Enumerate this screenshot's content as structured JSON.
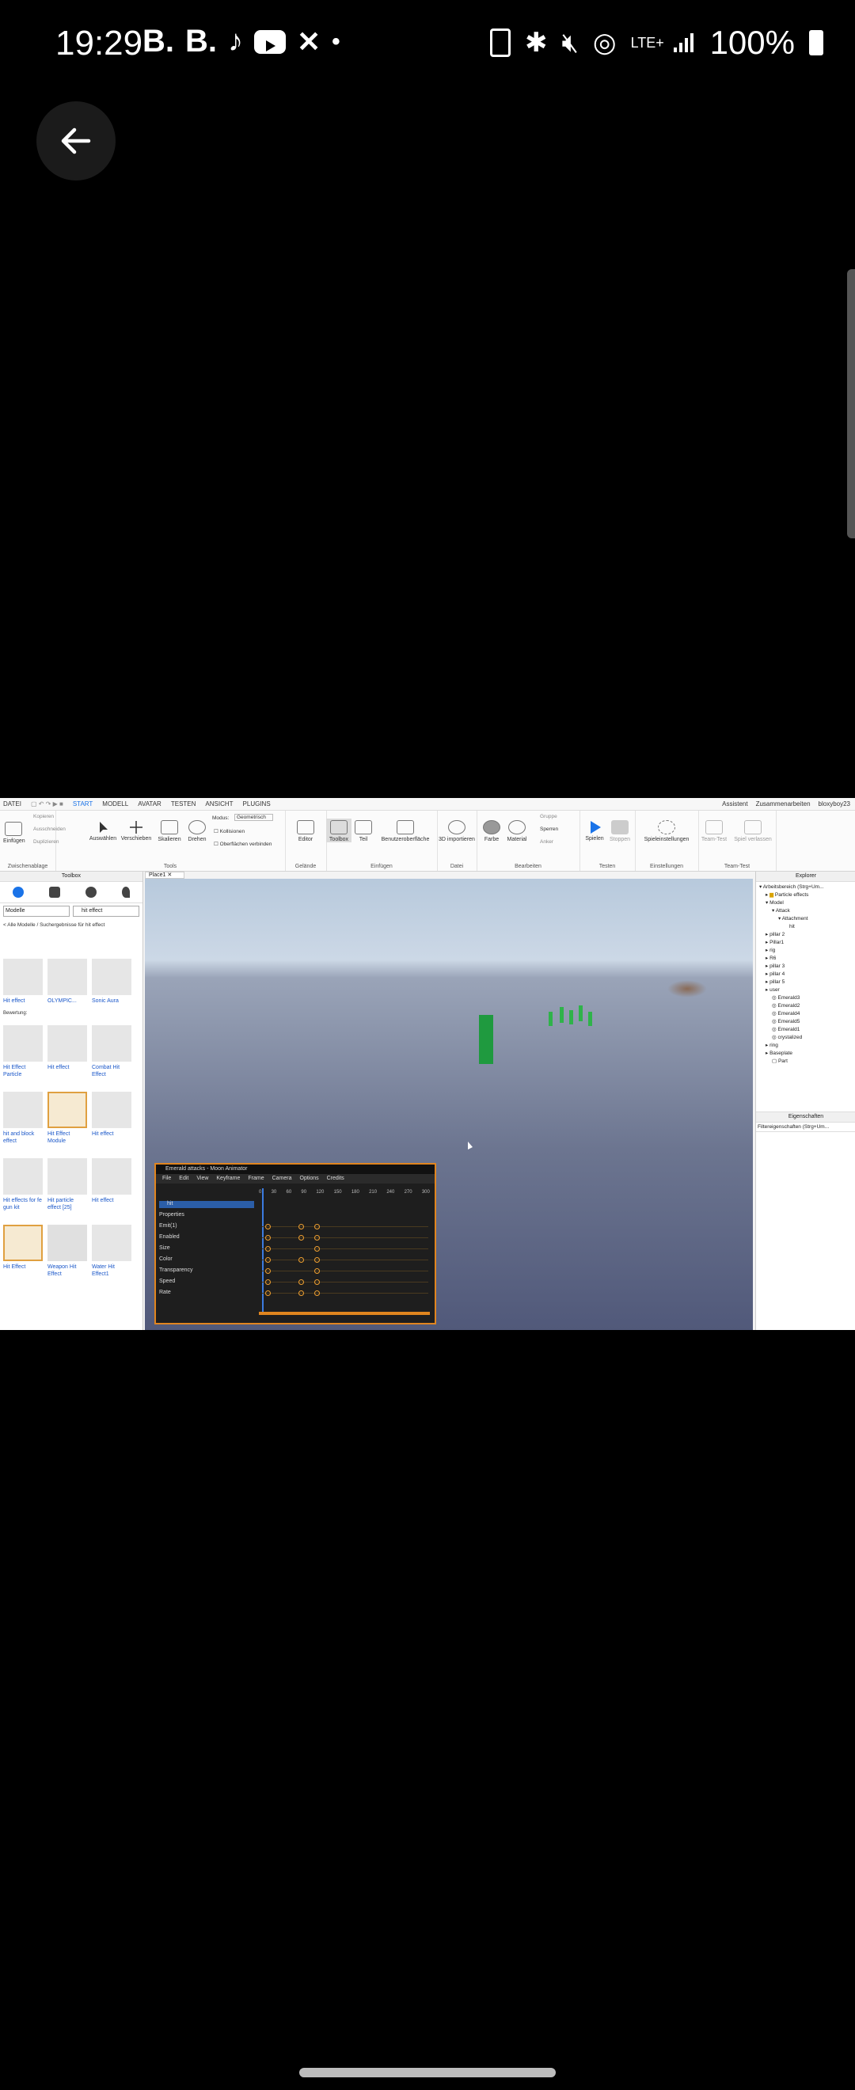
{
  "status_bar": {
    "time": "19:29",
    "left_icons": [
      "B.",
      "B.",
      "tiktok-icon",
      "youtube-icon",
      "capcut-icon",
      "•"
    ],
    "battery": "100%",
    "network": "LTE+"
  },
  "studio": {
    "menu_tabs": [
      "DATEI",
      "START",
      "MODELL",
      "AVATAR",
      "TESTEN",
      "ANSICHT",
      "PLUGINS"
    ],
    "menu_right": [
      "Assistent",
      "Zusammenarbeiten",
      "bloxyboy23"
    ],
    "ribbon": {
      "clipboard": {
        "items": [
          "Kopieren",
          "Ausschneiden",
          "Duplizieren"
        ],
        "paste": "Einfügen",
        "label": "Zwischenablage"
      },
      "tools": {
        "buttons": [
          "Auswählen",
          "Verschieben",
          "Skalieren",
          "Drehen"
        ],
        "mode_label": "Modus:",
        "mode_value": "Geometrisch",
        "options": [
          "Kollisionen",
          "Oberflächen verbinden"
        ],
        "label": "Tools"
      },
      "terrain": {
        "buttons": [
          "Editor"
        ],
        "label": "Gelände"
      },
      "insert": {
        "buttons": [
          "Toolbox",
          "Teil",
          "Benutzeroberfläche"
        ],
        "label": "Einfügen"
      },
      "file": {
        "buttons": [
          "3D importieren"
        ],
        "label": "Datei"
      },
      "edit": {
        "buttons": [
          "Farbe",
          "Material"
        ],
        "options": [
          "Gruppe",
          "Sperren",
          "Anker"
        ],
        "label": "Bearbeiten"
      },
      "test": {
        "buttons": [
          "Spielen",
          "Stoppen"
        ],
        "label": "Testen"
      },
      "settings": {
        "buttons": [
          "Spieleinstellungen"
        ],
        "label": "Einstellungen"
      },
      "team_test": {
        "buttons": [
          "Team-Test",
          "Spiel verlassen"
        ],
        "label": "Team-Test"
      }
    },
    "toolbox": {
      "title": "Toolbox",
      "filter": "Modelle",
      "search": "hit effect",
      "breadcrumb": "< Alle Modelle / Suchergebnisse für hit effect",
      "rating_label": "Bewertung:",
      "items": [
        "Hit effect",
        "OLYMPIC...",
        "Sonic Aura",
        "Hit Effect Particle",
        "Hit effect",
        "Combat Hit Effect",
        "hit and block effect",
        "Hit Effect Module",
        "Hit effect",
        "Hit effects for fe gun kit",
        "Hit particle effect [25]",
        "Hit effect",
        "Hit Effect",
        "Weapon Hit Effect",
        "Water Hit Effect1"
      ]
    },
    "viewport_tab": "Place1",
    "explorer": {
      "title": "Explorer",
      "items": [
        "Arbeitsbereich (Strg+Um...",
        "Particle effects",
        "Model",
        "Attack",
        "Attachment",
        "hit",
        "pillar 2",
        "Pillar1",
        "rig",
        "R6",
        "pillar 3",
        "pillar 4",
        "pillar 5",
        "user",
        "Emerald3",
        "Emerald2",
        "Emerald4",
        "Emerald5",
        "Emerald1",
        "crystalized",
        "ring",
        "Baseplate",
        "Part"
      ],
      "properties_title": "Eigenschaften",
      "properties_filter": "Filtereigenschaften (Strg+Um..."
    },
    "animator": {
      "title": "Emerald attacks - Moon Animator",
      "menu": [
        "File",
        "Edit",
        "View",
        "Keyframe",
        "Frame",
        "Camera",
        "Options",
        "Credits"
      ],
      "tracks": [
        "hit",
        "Properties",
        "Emit(1)",
        "Enabled",
        "Size",
        "Color",
        "Transparency",
        "Speed",
        "Rate"
      ],
      "timeline": [
        "0",
        "30",
        "60",
        "90",
        "120",
        "150",
        "180",
        "210",
        "240",
        "270",
        "300"
      ]
    }
  }
}
